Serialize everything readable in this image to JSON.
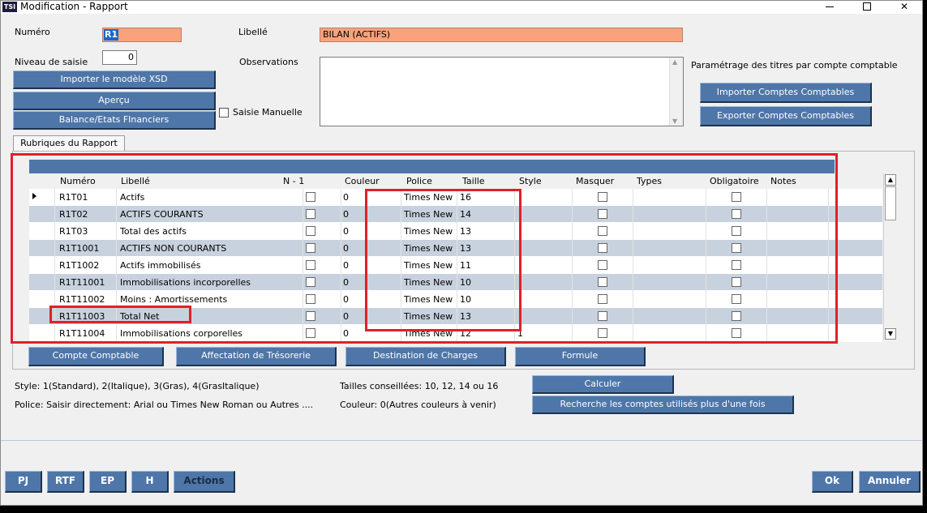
{
  "window": {
    "title": "Modification - Rapport",
    "app_icon_text": "TSI"
  },
  "form": {
    "numero_label": "Numéro",
    "numero_value": "R1",
    "libelle_label": "Libellé",
    "libelle_value": "BILAN (ACTIFS)",
    "niveau_label": "Niveau de saisie",
    "niveau_value": "0",
    "observations_label": "Observations",
    "saisie_manuelle_label": "Saisie Manuelle",
    "parametrage_label": "Paramétrage des titres par compte comptable"
  },
  "buttons": {
    "importer_xsd": "Importer le modèle XSD",
    "apercu": "Aperçu",
    "balance": "Balance/Etats FInanciers",
    "importer_comptes": "Importer Comptes Comptables",
    "exporter_comptes": "Exporter Comptes Comptables",
    "compte_comptable": "Compte Comptable",
    "affectation": "Affectation de Trésorerie",
    "destination": "Destination de Charges",
    "formule": "Formule",
    "calculer": "Calculer",
    "recherche": "Recherche les comptes utilisés plus d'une fois",
    "pj": "PJ",
    "rtf": "RTF",
    "ep": "EP",
    "h": "H",
    "actions": "Actions",
    "ok": "Ok",
    "annuler": "Annuler"
  },
  "tab": {
    "label": "Rubriques du Rapport"
  },
  "grid": {
    "columns": [
      "Numéro",
      "Libellé",
      "N - 1",
      "Couleur",
      "Police",
      "Taille",
      "Style",
      "Masquer",
      "Types",
      "Obligatoire",
      "Notes"
    ],
    "rows": [
      {
        "numero": "R1T01",
        "libelle": "Actifs",
        "couleur": "0",
        "police": "Times New",
        "taille": "16",
        "style": ""
      },
      {
        "numero": "R1T02",
        "libelle": "ACTIFS COURANTS",
        "couleur": "0",
        "police": "Times New",
        "taille": "14",
        "style": ""
      },
      {
        "numero": "R1T03",
        "libelle": "Total des actifs",
        "couleur": "0",
        "police": "Times New",
        "taille": "13",
        "style": ""
      },
      {
        "numero": "R1T1001",
        "libelle": "ACTIFS NON COURANTS",
        "couleur": "0",
        "police": "Times New",
        "taille": "13",
        "style": ""
      },
      {
        "numero": "R1T1002",
        "libelle": "Actifs immobilisés",
        "couleur": "0",
        "police": "Times New",
        "taille": "11",
        "style": ""
      },
      {
        "numero": "R1T11001",
        "libelle": "Immobilisations incorporelles",
        "couleur": "0",
        "police": "Times New",
        "taille": "10",
        "style": ""
      },
      {
        "numero": "R1T11002",
        "libelle": "Moins : Amortissements",
        "couleur": "0",
        "police": "Times New",
        "taille": "10",
        "style": ""
      },
      {
        "numero": "R1T11003",
        "libelle": "Total Net",
        "couleur": "0",
        "police": "Times New",
        "taille": "13",
        "style": ""
      },
      {
        "numero": "R1T11004",
        "libelle": "Immobilisations corporelles",
        "couleur": "0",
        "police": "Times New",
        "taille": "12",
        "style": "1"
      }
    ]
  },
  "info": {
    "style_text": "Style: 1(Standard), 2(Italique),  3(Gras), 4(GrasItalique)",
    "tailles_text": "Tailles conseillées: 10, 12, 14 ou 16",
    "police_text": "Police: Saisir directement: Arial ou Times New Roman ou Autres ....",
    "couleur_text": "Couleur: 0(Autres couleurs à venir)"
  },
  "colors": {
    "button_blue": "#4e76a9",
    "orange_field": "#f9a27c",
    "row_alt": "#c8d2de",
    "highlight_red": "#e0202a"
  }
}
